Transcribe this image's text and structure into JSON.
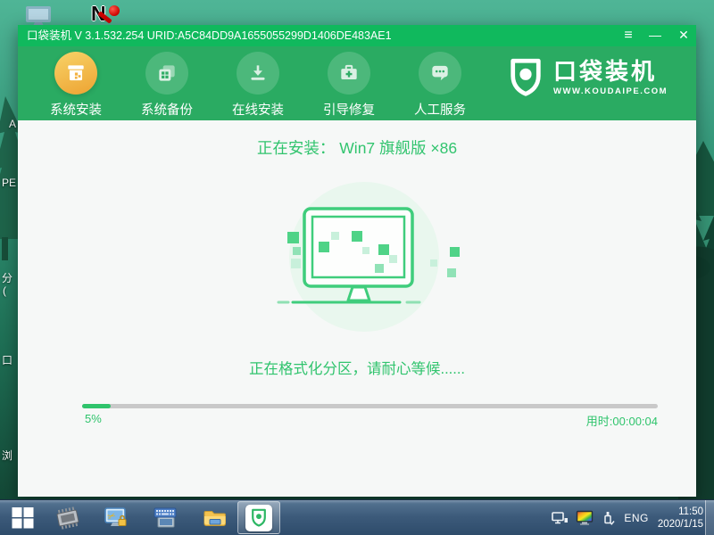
{
  "desktop": {
    "n_letter": "N",
    "edge_labels": {
      "a": "A",
      "pe": "PE",
      "fen": "分",
      "paren": "(",
      "kou": "口",
      "liu": "浏"
    }
  },
  "window": {
    "titlebar": {
      "title": "口袋装机 V 3.1.532.254 URID:A5C84DD9A1655055299D1406DE483AE1",
      "menu_glyph": "≡",
      "minimize_glyph": "—",
      "close_glyph": "✕"
    },
    "nav": {
      "items": [
        {
          "label": "系统安装",
          "active": true
        },
        {
          "label": "系统备份",
          "active": false
        },
        {
          "label": "在线安装",
          "active": false
        },
        {
          "label": "引导修复",
          "active": false
        },
        {
          "label": "人工服务",
          "active": false
        }
      ]
    },
    "logo": {
      "title": "口袋装机",
      "site": "WWW.KOUDAIPE.COM"
    },
    "main": {
      "installing_title": "正在安装： Win7 旗舰版 ×86",
      "status_text": "正在格式化分区，请耐心等候......",
      "progress_percent": "5%",
      "progress_style": "width:5%",
      "elapsed": "用时:00:00:04"
    }
  },
  "taskbar": {
    "language": "ENG",
    "time": "11:50",
    "date": "2020/1/15"
  },
  "colors": {
    "titlebar_green": "#10b95d",
    "nav_green": "#2aab62",
    "accent_green": "#31c46e",
    "active_orange": "#f0a936",
    "illustration_green": "#3fcd7c",
    "taskbar_blue": "#3c5a7a"
  }
}
